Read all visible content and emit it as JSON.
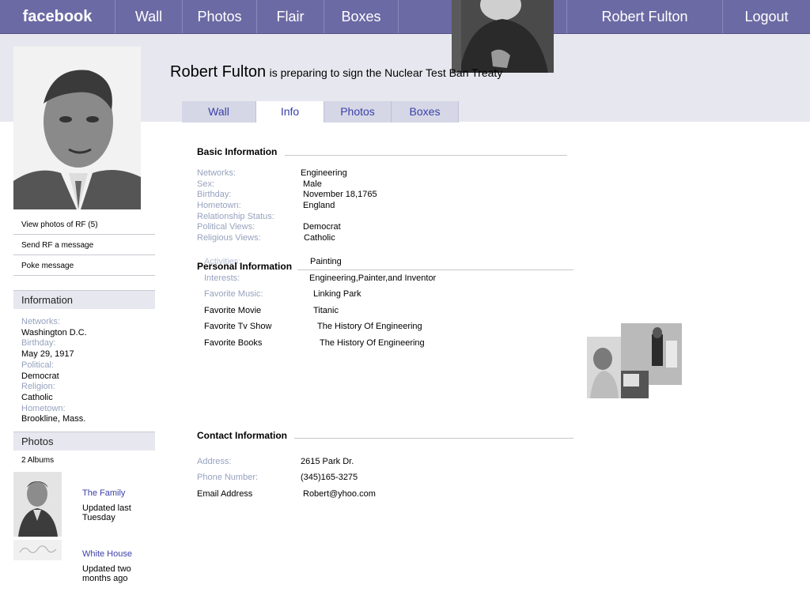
{
  "nav": {
    "logo": "facebook",
    "items": [
      "Wall",
      "Photos",
      "Flair",
      "Boxes"
    ],
    "user": "Robert Fulton",
    "logout": "Logout"
  },
  "header": {
    "name": "Robert Fulton",
    "status": "is preparing to sign the Nuclear Test Ban Treaty"
  },
  "tabs": [
    "Wall",
    "Info",
    "Photos",
    "Boxes"
  ],
  "active_tab": "Info",
  "sidebar": {
    "links": [
      "View photos of RF (5)",
      "Send RF a message",
      "Poke message"
    ],
    "info_title": "Information",
    "info": [
      {
        "label": "Networks:",
        "value": "Washington D.C."
      },
      {
        "label": "Birthday:",
        "value": "May 29, 1917"
      },
      {
        "label": "Political:",
        "value": "Democrat"
      },
      {
        "label": "Religion:",
        "value": "Catholic"
      },
      {
        "label": "Hometown:",
        "value": "Brookline, Mass."
      }
    ],
    "photos_title": "Photos",
    "albums_count": "2 Albums",
    "albums": [
      {
        "name": "The Family",
        "updated": "Updated last Tuesday"
      },
      {
        "name": "White House",
        "updated": "Updated two months ago"
      }
    ]
  },
  "basic": {
    "title": "Basic Information",
    "fields": [
      {
        "label": "Networks:",
        "value": "Engineering"
      },
      {
        "label": "Sex:",
        "value": "Male"
      },
      {
        "label": "Birthday:",
        "value": "November 18,1765"
      },
      {
        "label": "Hometown:",
        "value": "England"
      },
      {
        "label": "Relationship Status:",
        "value": ""
      },
      {
        "label": "Political Views:",
        "value": "Democrat"
      },
      {
        "label": "Religious Views:",
        "value": "Catholic"
      }
    ]
  },
  "personal": {
    "title": "Personal Information",
    "fields": [
      {
        "label": "Activities:",
        "value": "Painting"
      },
      {
        "label": "Interests:",
        "value": "Engineering,Painter,and  Inventor"
      },
      {
        "label": "Favorite Music:",
        "value": "Linking  Park"
      },
      {
        "label": "Favorite Movie",
        "value": "Titanic"
      },
      {
        "label": "Favorite Tv  Show",
        "value": "The  History  Of  Engineering"
      },
      {
        "label": "Favorite  Books",
        "value": "The  History  Of  Engineering"
      }
    ]
  },
  "contact": {
    "title": "Contact Information",
    "fields": [
      {
        "label": "Address:",
        "value": "2615  Park  Dr."
      },
      {
        "label": "Phone Number:",
        "value": "(345)165-3275"
      },
      {
        "label": "Email  Address",
        "value": "Robert@yhoo.com"
      }
    ]
  }
}
